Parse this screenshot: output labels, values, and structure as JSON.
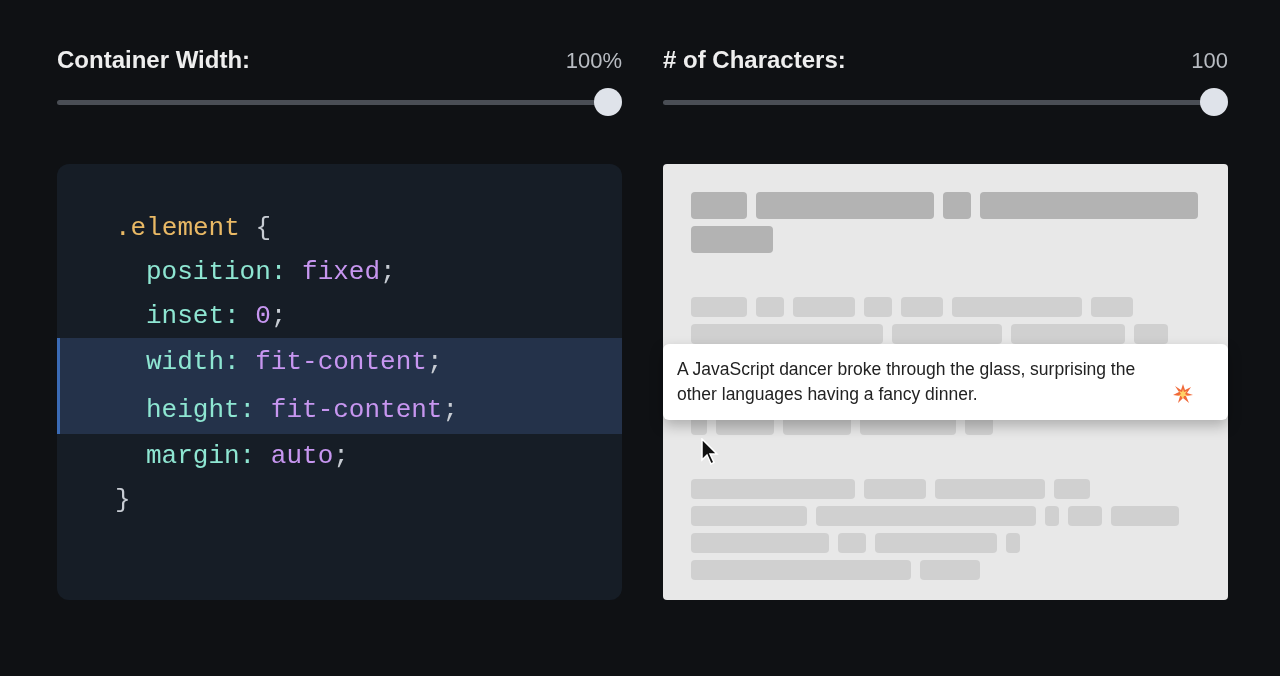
{
  "controls": [
    {
      "label": "Container Width:",
      "reading": "100%",
      "level": 1
    },
    {
      "label": "# of Characters:",
      "reading": "100",
      "level": 1
    }
  ],
  "code": {
    "selector": ".element",
    "open": "{",
    "close": "}",
    "declarations": [
      {
        "property": "position:",
        "value": "fixed",
        "end": ";",
        "highlighted": false
      },
      {
        "property": "inset:",
        "value": "0",
        "end": ";",
        "highlighted": false
      },
      {
        "property": "width:",
        "value": "fit-content",
        "end": ";",
        "highlighted": true
      },
      {
        "property": "height:",
        "value": "fit-content",
        "end": ";",
        "highlighted": true
      },
      {
        "property": "margin:",
        "value": "auto",
        "end": ";",
        "highlighted": false
      }
    ]
  },
  "preview": {
    "tooltip": "A JavaScript dancer broke through the glass, surprising the other languages having a fancy dinner."
  }
}
